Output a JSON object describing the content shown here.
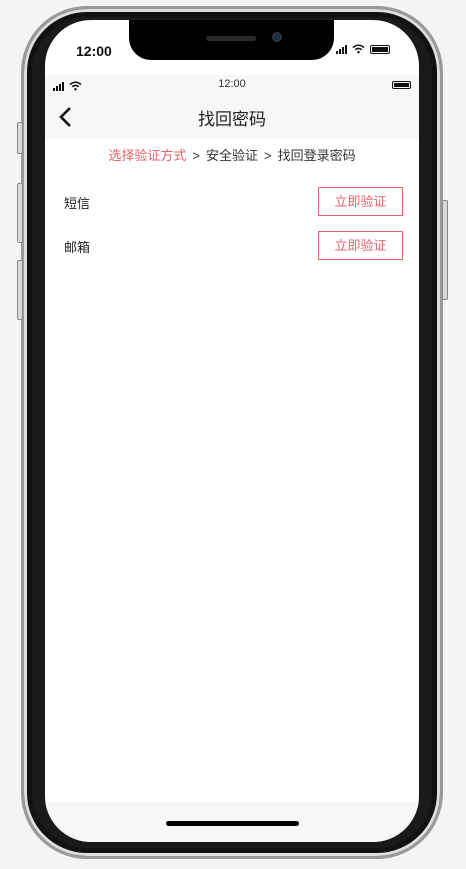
{
  "device": {
    "outer_time": "12:00"
  },
  "inner_status": {
    "time": "12:00"
  },
  "navbar": {
    "title": "找回密码",
    "back_icon": "chevron-left-icon"
  },
  "steps": {
    "step1": "选择验证方式",
    "separator1": ">",
    "step2": "安全验证",
    "separator2": ">",
    "step3": "找回登录密码",
    "active_color": "#e8636a"
  },
  "methods": [
    {
      "label": "短信",
      "button_label": "立即验证"
    },
    {
      "label": "邮箱",
      "button_label": "立即验证"
    }
  ],
  "colors": {
    "accent": "#e8636a",
    "page_bg": "#ffffff",
    "bar_bg": "#f7f7f7"
  }
}
